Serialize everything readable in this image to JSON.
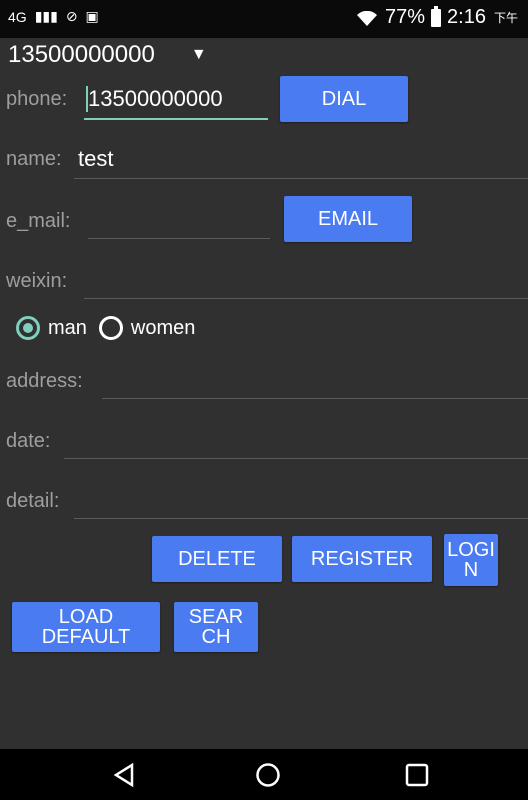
{
  "status_bar": {
    "network": "4G",
    "battery_percent": "77%",
    "time": "2:16",
    "period": "下午"
  },
  "spinner": {
    "selected": "13500000000"
  },
  "form": {
    "phone_label": "phone:",
    "phone_value": "13500000000",
    "name_label": "name:",
    "name_value": "test",
    "email_label": "e_mail:",
    "weixin_label": "weixin:",
    "gender_options": [
      "man",
      "women"
    ],
    "address_label": "address:",
    "date_label": "date:",
    "detail_label": "detail:"
  },
  "buttons": {
    "dial": "DIAL",
    "email": "EMAIL",
    "delete": "DELETE",
    "register": "REGISTER",
    "login_line1": "LOGI",
    "login_line2": "N",
    "load_default_line1": "LOAD",
    "load_default_line2": "DEFAULT",
    "search_line1": "SEAR",
    "search_line2": "CH"
  },
  "colors": {
    "background": "#303030",
    "button": "#4a7bf0",
    "accent": "#7fcfbd"
  }
}
